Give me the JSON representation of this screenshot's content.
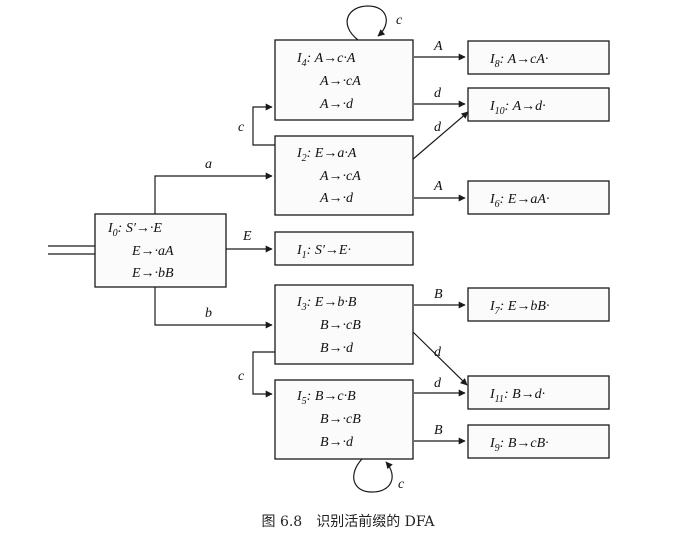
{
  "caption": "图 6.8　识别活前缀的 DFA",
  "states": {
    "I0": {
      "name": "I",
      "sub": "0",
      "items": [
        "S′→·E",
        "E→·aA",
        "E→·bB"
      ]
    },
    "I1": {
      "name": "I",
      "sub": "1",
      "items": [
        "S′→E·"
      ]
    },
    "I2": {
      "name": "I",
      "sub": "2",
      "items": [
        "E→a·A",
        "A→·cA",
        "A→·d"
      ]
    },
    "I3": {
      "name": "I",
      "sub": "3",
      "items": [
        "E→b·B",
        "B→·cB",
        "B→·d"
      ]
    },
    "I4": {
      "name": "I",
      "sub": "4",
      "items": [
        "A→c·A",
        "A→·cA",
        "A→·d"
      ]
    },
    "I5": {
      "name": "I",
      "sub": "5",
      "items": [
        "B→c·B",
        "B→·cB",
        "B→·d"
      ]
    },
    "I6": {
      "name": "I",
      "sub": "6",
      "items": [
        "E→aA·"
      ]
    },
    "I7": {
      "name": "I",
      "sub": "7",
      "items": [
        "E→bB·"
      ]
    },
    "I8": {
      "name": "I",
      "sub": "8",
      "items": [
        "A→cA·"
      ]
    },
    "I9": {
      "name": "I",
      "sub": "9",
      "items": [
        "B→cB·"
      ]
    },
    "I10": {
      "name": "I",
      "sub": "10",
      "items": [
        "A→d·"
      ]
    },
    "I11": {
      "name": "I",
      "sub": "11",
      "items": [
        "B→d·"
      ]
    }
  },
  "transitions": [
    {
      "from": "I0",
      "to": "I2",
      "label": "a"
    },
    {
      "from": "I0",
      "to": "I1",
      "label": "E"
    },
    {
      "from": "I0",
      "to": "I3",
      "label": "b"
    },
    {
      "from": "I2",
      "to": "I4",
      "label": "c"
    },
    {
      "from": "I2",
      "to": "I10",
      "label": "d"
    },
    {
      "from": "I2",
      "to": "I6",
      "label": "A"
    },
    {
      "from": "I4",
      "to": "I4",
      "label": "c"
    },
    {
      "from": "I4",
      "to": "I8",
      "label": "A"
    },
    {
      "from": "I4",
      "to": "I10",
      "label": "d"
    },
    {
      "from": "I3",
      "to": "I7",
      "label": "B"
    },
    {
      "from": "I3",
      "to": "I5",
      "label": "c"
    },
    {
      "from": "I3",
      "to": "I11",
      "label": "d"
    },
    {
      "from": "I5",
      "to": "I5",
      "label": "c"
    },
    {
      "from": "I5",
      "to": "I11",
      "label": "d"
    },
    {
      "from": "I5",
      "to": "I9",
      "label": "B"
    }
  ]
}
